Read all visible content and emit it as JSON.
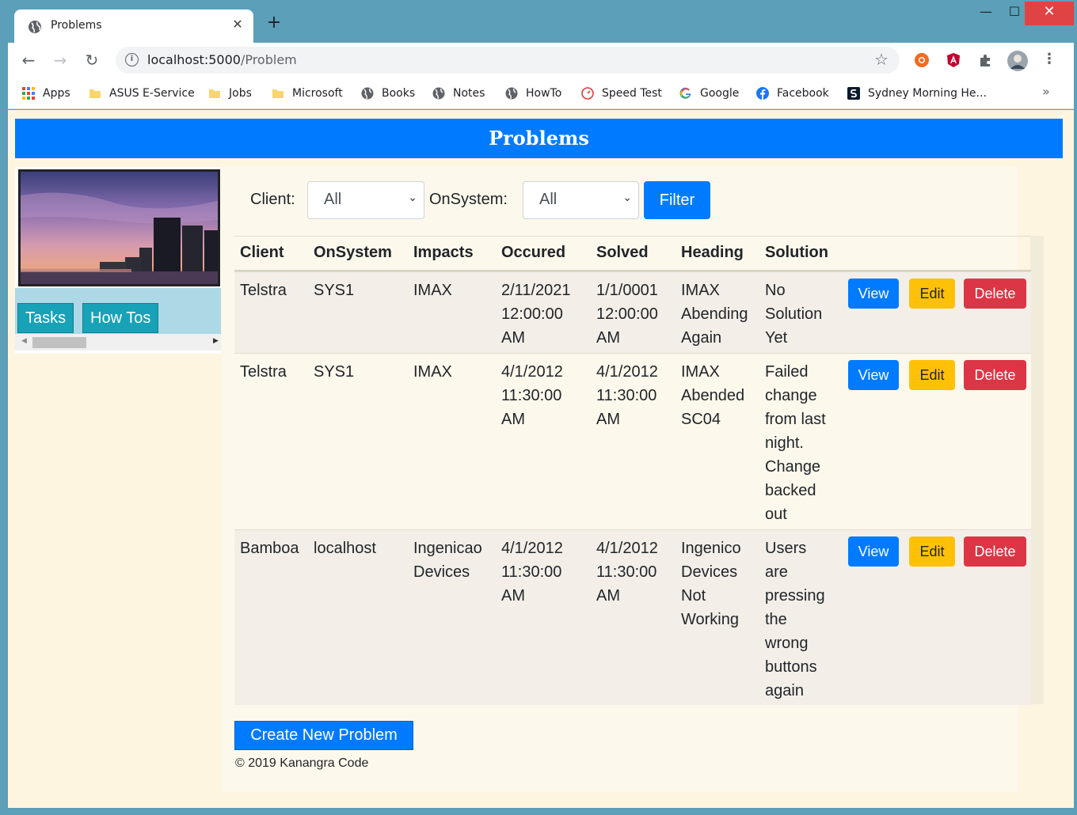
{
  "browser": {
    "tab_title": "Problems",
    "close_glyph": "✕",
    "new_tab_glyph": "+",
    "window_controls": {
      "minimize": "—",
      "maximize": "☐",
      "close": "✕"
    },
    "url_host": "localhost:5000",
    "url_path": "/Problem",
    "bookmarks": [
      {
        "label": "Apps",
        "icon": "apps-grid-icon"
      },
      {
        "label": "ASUS E-Service",
        "icon": "folder-icon"
      },
      {
        "label": "Jobs",
        "icon": "folder-icon"
      },
      {
        "label": "Microsoft",
        "icon": "folder-icon"
      },
      {
        "label": "Books",
        "icon": "globe-icon"
      },
      {
        "label": "Notes",
        "icon": "globe-icon"
      },
      {
        "label": "HowTo",
        "icon": "globe-icon"
      },
      {
        "label": "Speed Test",
        "icon": "speedometer-icon"
      },
      {
        "label": "Google",
        "icon": "google-icon"
      },
      {
        "label": "Facebook",
        "icon": "facebook-icon"
      },
      {
        "label": "Sydney Morning He...",
        "icon": "smh-icon"
      }
    ],
    "more_glyph": "»"
  },
  "header": {
    "title": "Problems"
  },
  "sidebar": {
    "nav": [
      {
        "label": "Tasks"
      },
      {
        "label": "How Tos"
      }
    ]
  },
  "filter": {
    "client_label": "Client:",
    "client_value": "All",
    "onsystem_label": "OnSystem:",
    "onsystem_value": "All",
    "button_label": "Filter"
  },
  "table": {
    "columns": [
      "Client",
      "OnSystem",
      "Impacts",
      "Occured",
      "Solved",
      "Heading",
      "Solution"
    ],
    "rows": [
      {
        "client": "Telstra",
        "onsystem": "SYS1",
        "impacts": [
          "IMAX"
        ],
        "occured": [
          "2/11/2021",
          "12:00:00",
          "AM"
        ],
        "solved": [
          "1/1/0001",
          "12:00:00",
          "AM"
        ],
        "heading": [
          "IMAX",
          "Abending",
          "Again"
        ],
        "solution": [
          "No",
          "Solution",
          "Yet"
        ]
      },
      {
        "client": "Telstra",
        "onsystem": "SYS1",
        "impacts": [
          "IMAX"
        ],
        "occured": [
          "4/1/2012",
          "11:30:00",
          "AM"
        ],
        "solved": [
          "4/1/2012",
          "11:30:00",
          "AM"
        ],
        "heading": [
          "IMAX",
          "Abended",
          "SC04"
        ],
        "solution": [
          "Failed",
          "change",
          "from last",
          "night.",
          "Change",
          "backed",
          "out"
        ]
      },
      {
        "client": "Bamboa",
        "onsystem": "localhost",
        "impacts": [
          "Ingenicao",
          "Devices"
        ],
        "occured": [
          "4/1/2012",
          "11:30:00",
          "AM"
        ],
        "solved": [
          "4/1/2012",
          "11:30:00",
          "AM"
        ],
        "heading": [
          "Ingenico",
          "Devices",
          "Not",
          "Working"
        ],
        "solution": [
          "Users",
          "are",
          "pressing",
          "the",
          "wrong",
          "buttons",
          "again"
        ]
      }
    ],
    "actions": {
      "view": "View",
      "edit": "Edit",
      "delete": "Delete"
    }
  },
  "create_button": "Create New Problem",
  "footer": "© 2019 Kanangra Code",
  "colors": {
    "primary": "#007bff",
    "warning": "#ffc107",
    "danger": "#dc3545",
    "info": "#17a2b8",
    "page_bg": "#fdf5df"
  }
}
